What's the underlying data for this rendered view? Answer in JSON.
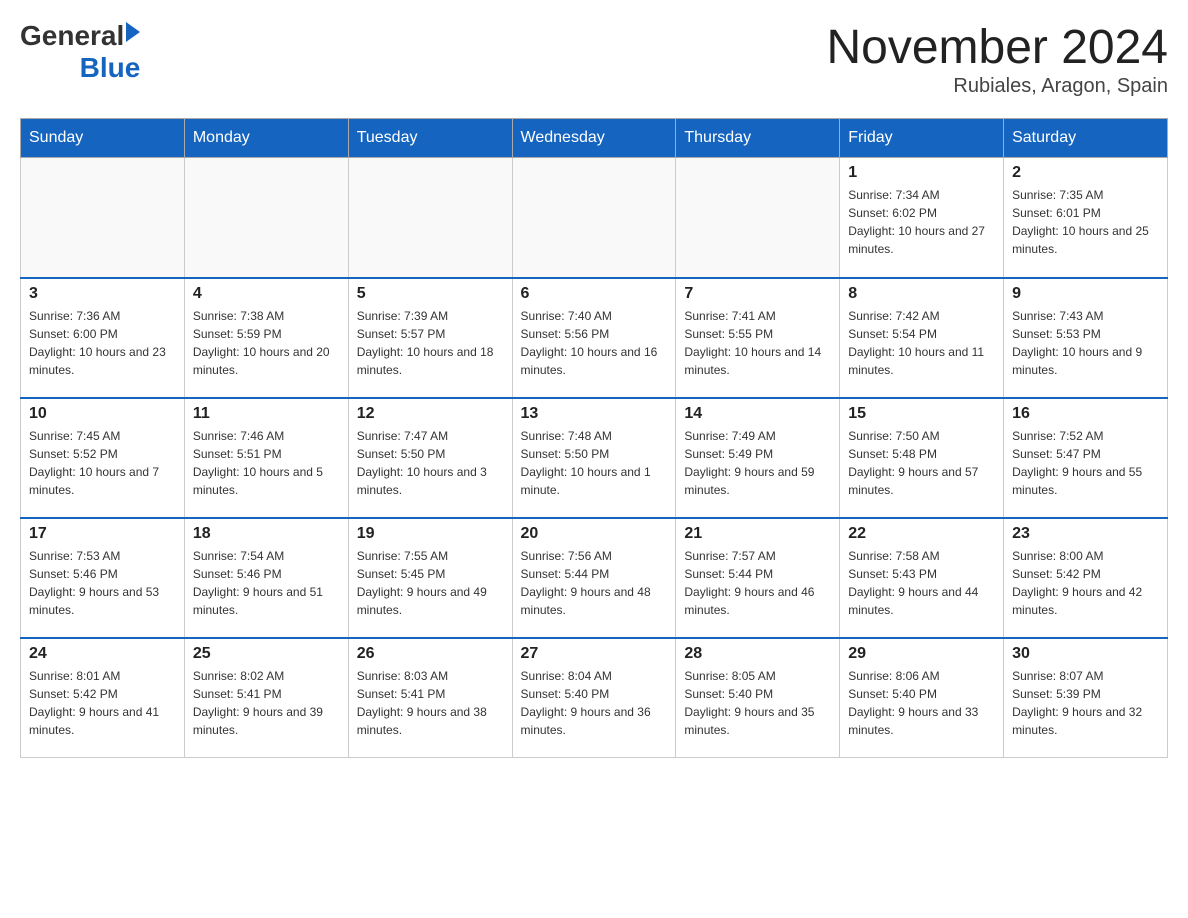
{
  "header": {
    "logo": {
      "general": "General",
      "arrow": "▶",
      "blue": "Blue"
    },
    "title": "November 2024",
    "location": "Rubiales, Aragon, Spain"
  },
  "calendar": {
    "days_of_week": [
      "Sunday",
      "Monday",
      "Tuesday",
      "Wednesday",
      "Thursday",
      "Friday",
      "Saturday"
    ],
    "weeks": [
      [
        {
          "day": "",
          "info": ""
        },
        {
          "day": "",
          "info": ""
        },
        {
          "day": "",
          "info": ""
        },
        {
          "day": "",
          "info": ""
        },
        {
          "day": "",
          "info": ""
        },
        {
          "day": "1",
          "info": "Sunrise: 7:34 AM\nSunset: 6:02 PM\nDaylight: 10 hours and 27 minutes."
        },
        {
          "day": "2",
          "info": "Sunrise: 7:35 AM\nSunset: 6:01 PM\nDaylight: 10 hours and 25 minutes."
        }
      ],
      [
        {
          "day": "3",
          "info": "Sunrise: 7:36 AM\nSunset: 6:00 PM\nDaylight: 10 hours and 23 minutes."
        },
        {
          "day": "4",
          "info": "Sunrise: 7:38 AM\nSunset: 5:59 PM\nDaylight: 10 hours and 20 minutes."
        },
        {
          "day": "5",
          "info": "Sunrise: 7:39 AM\nSunset: 5:57 PM\nDaylight: 10 hours and 18 minutes."
        },
        {
          "day": "6",
          "info": "Sunrise: 7:40 AM\nSunset: 5:56 PM\nDaylight: 10 hours and 16 minutes."
        },
        {
          "day": "7",
          "info": "Sunrise: 7:41 AM\nSunset: 5:55 PM\nDaylight: 10 hours and 14 minutes."
        },
        {
          "day": "8",
          "info": "Sunrise: 7:42 AM\nSunset: 5:54 PM\nDaylight: 10 hours and 11 minutes."
        },
        {
          "day": "9",
          "info": "Sunrise: 7:43 AM\nSunset: 5:53 PM\nDaylight: 10 hours and 9 minutes."
        }
      ],
      [
        {
          "day": "10",
          "info": "Sunrise: 7:45 AM\nSunset: 5:52 PM\nDaylight: 10 hours and 7 minutes."
        },
        {
          "day": "11",
          "info": "Sunrise: 7:46 AM\nSunset: 5:51 PM\nDaylight: 10 hours and 5 minutes."
        },
        {
          "day": "12",
          "info": "Sunrise: 7:47 AM\nSunset: 5:50 PM\nDaylight: 10 hours and 3 minutes."
        },
        {
          "day": "13",
          "info": "Sunrise: 7:48 AM\nSunset: 5:50 PM\nDaylight: 10 hours and 1 minute."
        },
        {
          "day": "14",
          "info": "Sunrise: 7:49 AM\nSunset: 5:49 PM\nDaylight: 9 hours and 59 minutes."
        },
        {
          "day": "15",
          "info": "Sunrise: 7:50 AM\nSunset: 5:48 PM\nDaylight: 9 hours and 57 minutes."
        },
        {
          "day": "16",
          "info": "Sunrise: 7:52 AM\nSunset: 5:47 PM\nDaylight: 9 hours and 55 minutes."
        }
      ],
      [
        {
          "day": "17",
          "info": "Sunrise: 7:53 AM\nSunset: 5:46 PM\nDaylight: 9 hours and 53 minutes."
        },
        {
          "day": "18",
          "info": "Sunrise: 7:54 AM\nSunset: 5:46 PM\nDaylight: 9 hours and 51 minutes."
        },
        {
          "day": "19",
          "info": "Sunrise: 7:55 AM\nSunset: 5:45 PM\nDaylight: 9 hours and 49 minutes."
        },
        {
          "day": "20",
          "info": "Sunrise: 7:56 AM\nSunset: 5:44 PM\nDaylight: 9 hours and 48 minutes."
        },
        {
          "day": "21",
          "info": "Sunrise: 7:57 AM\nSunset: 5:44 PM\nDaylight: 9 hours and 46 minutes."
        },
        {
          "day": "22",
          "info": "Sunrise: 7:58 AM\nSunset: 5:43 PM\nDaylight: 9 hours and 44 minutes."
        },
        {
          "day": "23",
          "info": "Sunrise: 8:00 AM\nSunset: 5:42 PM\nDaylight: 9 hours and 42 minutes."
        }
      ],
      [
        {
          "day": "24",
          "info": "Sunrise: 8:01 AM\nSunset: 5:42 PM\nDaylight: 9 hours and 41 minutes."
        },
        {
          "day": "25",
          "info": "Sunrise: 8:02 AM\nSunset: 5:41 PM\nDaylight: 9 hours and 39 minutes."
        },
        {
          "day": "26",
          "info": "Sunrise: 8:03 AM\nSunset: 5:41 PM\nDaylight: 9 hours and 38 minutes."
        },
        {
          "day": "27",
          "info": "Sunrise: 8:04 AM\nSunset: 5:40 PM\nDaylight: 9 hours and 36 minutes."
        },
        {
          "day": "28",
          "info": "Sunrise: 8:05 AM\nSunset: 5:40 PM\nDaylight: 9 hours and 35 minutes."
        },
        {
          "day": "29",
          "info": "Sunrise: 8:06 AM\nSunset: 5:40 PM\nDaylight: 9 hours and 33 minutes."
        },
        {
          "day": "30",
          "info": "Sunrise: 8:07 AM\nSunset: 5:39 PM\nDaylight: 9 hours and 32 minutes."
        }
      ]
    ]
  }
}
